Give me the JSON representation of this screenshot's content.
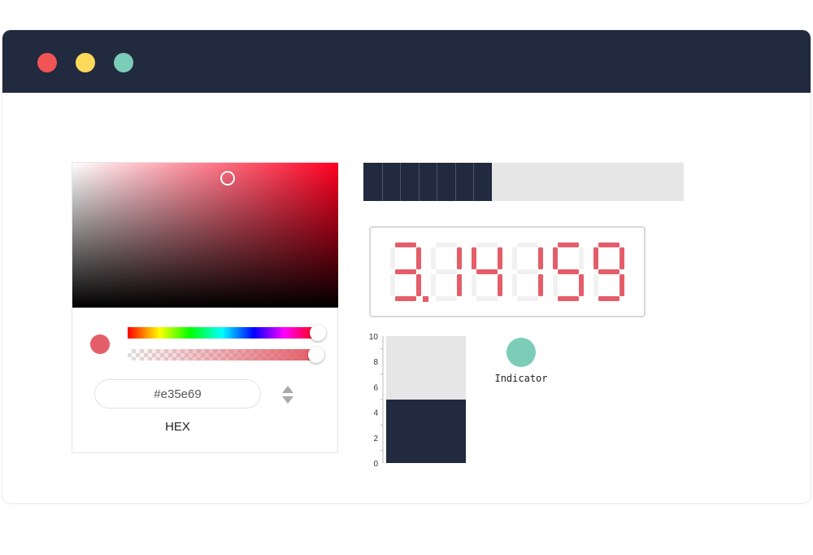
{
  "window": {
    "controls": [
      {
        "name": "close",
        "color": "#f05454"
      },
      {
        "name": "minimize",
        "color": "#ffd95a"
      },
      {
        "name": "zoom",
        "color": "#7ccdb8"
      }
    ],
    "titlebar_color": "#222a3f"
  },
  "color_picker": {
    "hex_value": "#e35e69",
    "mode_label": "HEX",
    "hue_color": "#ff0021",
    "alpha": 1.0
  },
  "progress_bar": {
    "value": 0.4,
    "segments": 7,
    "fill_color": "#222a3f"
  },
  "segment_display": {
    "value": "3.14159",
    "color": "#e35e69"
  },
  "bar_gauge": {
    "value": 5,
    "max": 10,
    "tick_labels": [
      "10",
      "8",
      "6",
      "4",
      "2",
      "0"
    ],
    "fill_color": "#222a3f"
  },
  "indicator": {
    "label": "Indicator",
    "color": "#7ccdb8"
  }
}
